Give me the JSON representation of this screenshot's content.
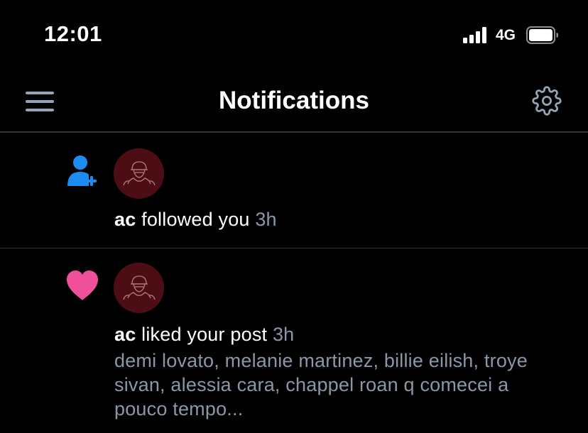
{
  "status_bar": {
    "time": "12:01",
    "network": "4G",
    "icons": [
      "signal-bars-icon",
      "battery-icon"
    ]
  },
  "header": {
    "title": "Notifications",
    "left_icon": "hamburger-menu-icon",
    "right_icon": "gear-icon"
  },
  "colors": {
    "background": "#000000",
    "divider": "#2e3440",
    "follow_icon": "#1d8cf2",
    "like_icon": "#f0509b",
    "secondary_text": "#8b97a8",
    "avatar_bg": "#4c0e14"
  },
  "notifications": [
    {
      "type": "follow",
      "icon": "follow-user-icon",
      "user": "ac",
      "action": "followed you",
      "time": "3h"
    },
    {
      "type": "like",
      "icon": "heart-icon",
      "user": "ac",
      "action": "liked your post",
      "time": "3h",
      "preview": "demi lovato, melanie martinez, billie eilish, troye sivan, alessia cara, chappel roan q comecei a pouco tempo..."
    }
  ]
}
